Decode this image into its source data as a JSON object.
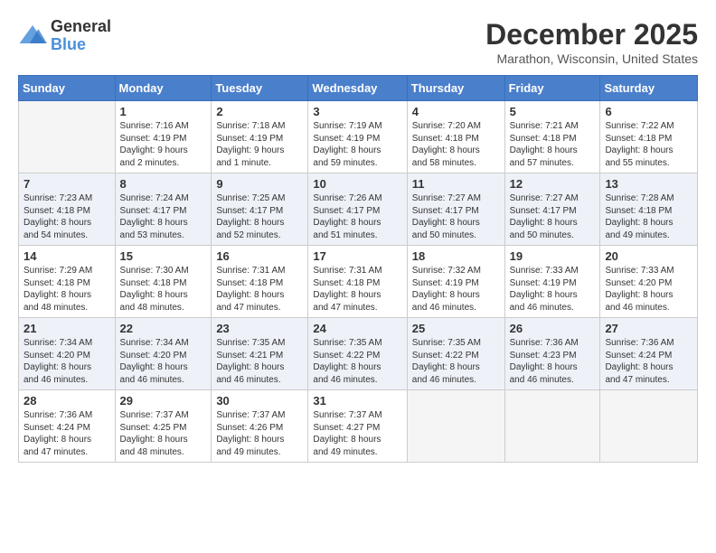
{
  "header": {
    "logo": {
      "general": "General",
      "blue": "Blue"
    },
    "title": "December 2025",
    "location": "Marathon, Wisconsin, United States"
  },
  "weekdays": [
    "Sunday",
    "Monday",
    "Tuesday",
    "Wednesday",
    "Thursday",
    "Friday",
    "Saturday"
  ],
  "weeks": [
    [
      {
        "day": "",
        "empty": true
      },
      {
        "day": "1",
        "sunrise": "7:16 AM",
        "sunset": "4:19 PM",
        "daylight": "9 hours and 2 minutes."
      },
      {
        "day": "2",
        "sunrise": "7:18 AM",
        "sunset": "4:19 PM",
        "daylight": "9 hours and 1 minute."
      },
      {
        "day": "3",
        "sunrise": "7:19 AM",
        "sunset": "4:19 PM",
        "daylight": "8 hours and 59 minutes."
      },
      {
        "day": "4",
        "sunrise": "7:20 AM",
        "sunset": "4:18 PM",
        "daylight": "8 hours and 58 minutes."
      },
      {
        "day": "5",
        "sunrise": "7:21 AM",
        "sunset": "4:18 PM",
        "daylight": "8 hours and 57 minutes."
      },
      {
        "day": "6",
        "sunrise": "7:22 AM",
        "sunset": "4:18 PM",
        "daylight": "8 hours and 55 minutes."
      }
    ],
    [
      {
        "day": "7",
        "sunrise": "7:23 AM",
        "sunset": "4:18 PM",
        "daylight": "8 hours and 54 minutes."
      },
      {
        "day": "8",
        "sunrise": "7:24 AM",
        "sunset": "4:17 PM",
        "daylight": "8 hours and 53 minutes."
      },
      {
        "day": "9",
        "sunrise": "7:25 AM",
        "sunset": "4:17 PM",
        "daylight": "8 hours and 52 minutes."
      },
      {
        "day": "10",
        "sunrise": "7:26 AM",
        "sunset": "4:17 PM",
        "daylight": "8 hours and 51 minutes."
      },
      {
        "day": "11",
        "sunrise": "7:27 AM",
        "sunset": "4:17 PM",
        "daylight": "8 hours and 50 minutes."
      },
      {
        "day": "12",
        "sunrise": "7:27 AM",
        "sunset": "4:17 PM",
        "daylight": "8 hours and 50 minutes."
      },
      {
        "day": "13",
        "sunrise": "7:28 AM",
        "sunset": "4:18 PM",
        "daylight": "8 hours and 49 minutes."
      }
    ],
    [
      {
        "day": "14",
        "sunrise": "7:29 AM",
        "sunset": "4:18 PM",
        "daylight": "8 hours and 48 minutes."
      },
      {
        "day": "15",
        "sunrise": "7:30 AM",
        "sunset": "4:18 PM",
        "daylight": "8 hours and 48 minutes."
      },
      {
        "day": "16",
        "sunrise": "7:31 AM",
        "sunset": "4:18 PM",
        "daylight": "8 hours and 47 minutes."
      },
      {
        "day": "17",
        "sunrise": "7:31 AM",
        "sunset": "4:18 PM",
        "daylight": "8 hours and 47 minutes."
      },
      {
        "day": "18",
        "sunrise": "7:32 AM",
        "sunset": "4:19 PM",
        "daylight": "8 hours and 46 minutes."
      },
      {
        "day": "19",
        "sunrise": "7:33 AM",
        "sunset": "4:19 PM",
        "daylight": "8 hours and 46 minutes."
      },
      {
        "day": "20",
        "sunrise": "7:33 AM",
        "sunset": "4:20 PM",
        "daylight": "8 hours and 46 minutes."
      }
    ],
    [
      {
        "day": "21",
        "sunrise": "7:34 AM",
        "sunset": "4:20 PM",
        "daylight": "8 hours and 46 minutes."
      },
      {
        "day": "22",
        "sunrise": "7:34 AM",
        "sunset": "4:20 PM",
        "daylight": "8 hours and 46 minutes."
      },
      {
        "day": "23",
        "sunrise": "7:35 AM",
        "sunset": "4:21 PM",
        "daylight": "8 hours and 46 minutes."
      },
      {
        "day": "24",
        "sunrise": "7:35 AM",
        "sunset": "4:22 PM",
        "daylight": "8 hours and 46 minutes."
      },
      {
        "day": "25",
        "sunrise": "7:35 AM",
        "sunset": "4:22 PM",
        "daylight": "8 hours and 46 minutes."
      },
      {
        "day": "26",
        "sunrise": "7:36 AM",
        "sunset": "4:23 PM",
        "daylight": "8 hours and 46 minutes."
      },
      {
        "day": "27",
        "sunrise": "7:36 AM",
        "sunset": "4:24 PM",
        "daylight": "8 hours and 47 minutes."
      }
    ],
    [
      {
        "day": "28",
        "sunrise": "7:36 AM",
        "sunset": "4:24 PM",
        "daylight": "8 hours and 47 minutes."
      },
      {
        "day": "29",
        "sunrise": "7:37 AM",
        "sunset": "4:25 PM",
        "daylight": "8 hours and 48 minutes."
      },
      {
        "day": "30",
        "sunrise": "7:37 AM",
        "sunset": "4:26 PM",
        "daylight": "8 hours and 49 minutes."
      },
      {
        "day": "31",
        "sunrise": "7:37 AM",
        "sunset": "4:27 PM",
        "daylight": "8 hours and 49 minutes."
      },
      {
        "day": "",
        "empty": true
      },
      {
        "day": "",
        "empty": true
      },
      {
        "day": "",
        "empty": true
      }
    ]
  ]
}
